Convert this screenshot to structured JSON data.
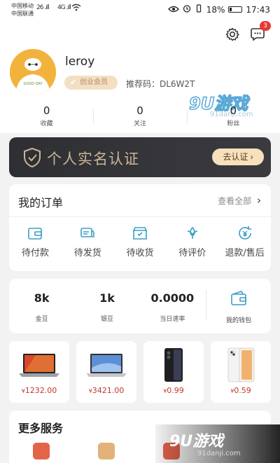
{
  "status_bar": {
    "carrier1": "中国移动",
    "carrier2": "中国联通",
    "sig1": "26 .ıll",
    "sig2": "4G .ıll",
    "battery": "18%",
    "time": "17:43"
  },
  "header": {
    "message_badge": "3",
    "avatar_text": "GOOD DAY"
  },
  "profile": {
    "username": "leroy",
    "member_tag": "创业会员",
    "referral": "推荐码：DL6W2T"
  },
  "stats": [
    {
      "value": "0",
      "label": "收藏"
    },
    {
      "value": "0",
      "label": "关注"
    },
    {
      "value": "0",
      "label": "粉丝"
    }
  ],
  "verify": {
    "title": "个人实名认证",
    "button": "去认证 ›"
  },
  "orders": {
    "title": "我的订单",
    "view_all": "查看全部",
    "items": [
      {
        "label": "待付款",
        "icon": "wallet-icon"
      },
      {
        "label": "待发货",
        "icon": "truck-icon"
      },
      {
        "label": "待收货",
        "icon": "box-icon"
      },
      {
        "label": "待评价",
        "icon": "flower-icon"
      },
      {
        "label": "退款/售后",
        "icon": "refund-icon"
      }
    ]
  },
  "wallet": {
    "items": [
      {
        "value": "8k",
        "label": "金豆"
      },
      {
        "value": "1k",
        "label": "银豆"
      },
      {
        "value": "0.0000",
        "label": "当日速率"
      }
    ],
    "my_wallet": "我的钱包"
  },
  "products": [
    {
      "currency": "¥",
      "price": "1232.00",
      "icon": "laptop-red-icon"
    },
    {
      "currency": "¥",
      "price": "3421.00",
      "icon": "laptop-silver-icon"
    },
    {
      "currency": "¥",
      "price": "0.99",
      "icon": "phone-black-icon"
    },
    {
      "currency": "¥",
      "price": "0.59",
      "icon": "phone-white-icon"
    }
  ],
  "more": {
    "title": "更多服务"
  },
  "watermark": {
    "top": "9U游戏",
    "top_sub": "91danji.com",
    "bottom": "9U游戏",
    "bottom_sub": "91danji.com"
  },
  "colors": {
    "accent": "#3a9fc4",
    "price": "#c0392b",
    "verify_bg": "#2e2f33",
    "gold": "#ccb697"
  }
}
